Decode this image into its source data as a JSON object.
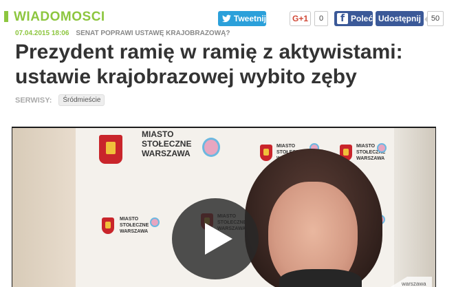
{
  "section": {
    "title": "WIADOMOSCI",
    "accent": "#8dc63f"
  },
  "share": {
    "tweet_label": "Tweetnij",
    "gplus_label": "G+1",
    "gplus_count": "0",
    "fb_like_label": "Poleć",
    "fb_share_label": "Udostępnij",
    "fb_share_count": "50"
  },
  "article": {
    "date": "07.04.2015 18:06",
    "related_tag": "SENAT POPRAWI USTAWĘ KRAJOBRAZOWĄ?",
    "headline": "Prezydent ramię w ramię z aktywistami: ustawie krajobrazowej wybito zęby",
    "services_label": "SERWISY:",
    "service_chip": "Śródmieście"
  },
  "video": {
    "banner_text_1": "MIASTO",
    "banner_text_2": "STOŁECZNE",
    "banner_text_3": "WARSZAWA",
    "watermark_text": "warszawa",
    "play_icon": "play-icon"
  }
}
